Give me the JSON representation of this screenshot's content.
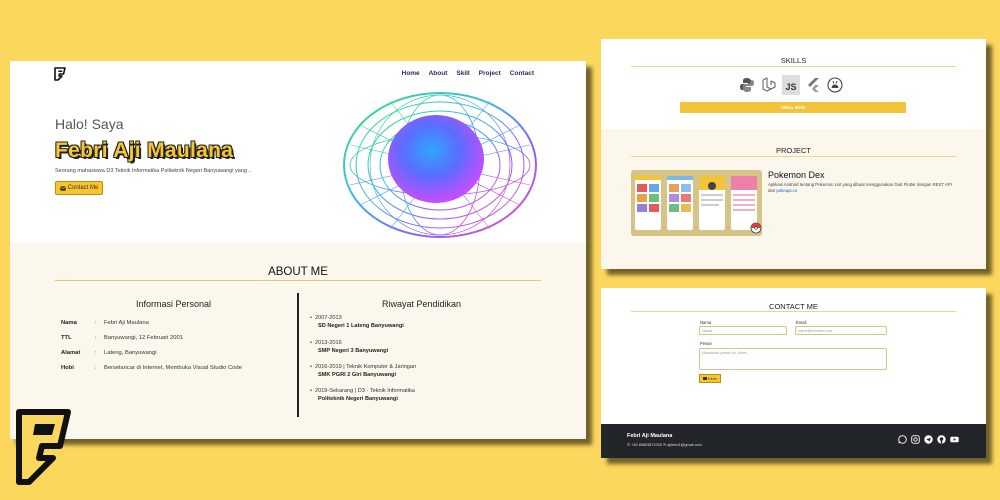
{
  "nav": {
    "items": [
      "Home",
      "About",
      "Skill",
      "Project",
      "Contact"
    ]
  },
  "hero": {
    "greeting": "Halo! Saya",
    "name": "Febri Aji Maulana",
    "description": "Seorang mahasiswa D3 Teknik Informatika Politeknik Negeri Banyuwangi yang ..",
    "contact_button": "Contact Me"
  },
  "about": {
    "title": "ABOUT ME",
    "personal": {
      "title": "Informasi Personal",
      "rows": [
        {
          "key": "Nama",
          "value": "Febri Aji Maulana"
        },
        {
          "key": "TTL",
          "value": "Banyuwangi, 12 Februari 2001"
        },
        {
          "key": "Alamat",
          "value": "Lateng, Banyuwangi"
        },
        {
          "key": "Hobi",
          "value": "Berselancar di Internet, Membuka Visual Studio Code"
        }
      ]
    },
    "education": {
      "title": "Riwayat Pendidikan",
      "items": [
        {
          "period": "2007-2013",
          "school": "SD Negeri 1 Lateng Banyuwangi"
        },
        {
          "period": "2013-2016",
          "school": "SMP Negeri 3 Banyuwangi"
        },
        {
          "period": "2016-2019 | Teknik Komputer & Jaringan",
          "school": "SMK PGRI 2 Giri Banyuwangi"
        },
        {
          "period": "2019-Sekarang | D3 - Teknik Informatika",
          "school": "Politeknik Negeri Banyuwangi"
        }
      ]
    }
  },
  "skills": {
    "title": "SKILLS",
    "icons": [
      "python-icon",
      "laravel-icon",
      "javascript-icon",
      "flutter-icon",
      "android-icon"
    ],
    "js_label": "JS",
    "bar_label": "SKILL BAR"
  },
  "project": {
    "title": "PROJECT",
    "name": "Pokemon Dex",
    "description": "Aplikasi Android tentang Pokemon List yang dibuat menggunakan Dart Flutter dengan REST API dari",
    "link": "pokeapi.co"
  },
  "contact": {
    "title": "CONTACT ME",
    "name_label": "Nama",
    "name_placeholder": "Nama",
    "email_label": "Email",
    "email_placeholder": "name@domain.com",
    "message_label": "Pesan",
    "message_placeholder": "Masukkan pesan ini. Kirim...",
    "send_label": "Kirim"
  },
  "footer": {
    "name": "Febri Aji Maulana",
    "phone": "+62 85853671000",
    "email": "ajifebri1@gmail.com",
    "social_icons": [
      "whatsapp-icon",
      "instagram-icon",
      "telegram-icon",
      "github-icon",
      "youtube-icon"
    ]
  },
  "colors": {
    "background": "#fcd75e",
    "accent": "#f7c62f",
    "nav_text": "#1d2b4f",
    "section_bg": "#fbf7ec",
    "footer_bg": "#22252a"
  }
}
